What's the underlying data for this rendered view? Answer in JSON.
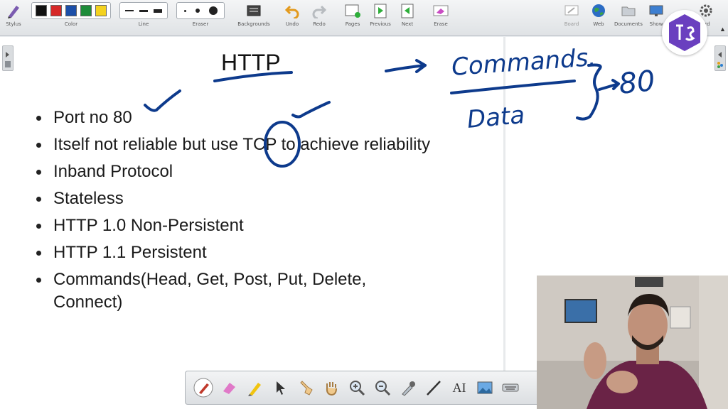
{
  "toolbar": {
    "stylus": "Stylus",
    "color": "Color",
    "line": "Line",
    "eraser": "Eraser",
    "backgrounds": "Backgrounds",
    "undo": "Undo",
    "redo": "Redo",
    "pages": "Pages",
    "previous": "Previous",
    "next": "Next",
    "erase": "Erase",
    "board": "Board",
    "web": "Web",
    "documents": "Documents",
    "show": "Show",
    "keyboard_partial": "ard",
    "colors": [
      "#111111",
      "#d62828",
      "#1c4fa8",
      "#1e8c3a",
      "#f4d21f"
    ]
  },
  "slide": {
    "title": "HTTP",
    "bullets": [
      "Port no 80",
      "Itself not reliable but use TCP to achieve reliability",
      "Inband Protocol",
      "Stateless",
      "HTTP 1.0 Non-Persistent",
      "HTTP 1.1 Persistent",
      "Commands(Head, Get, Post, Put, Delete, Connect)"
    ]
  },
  "annotations": {
    "commands": "Commands.",
    "data": "Data",
    "port": "80",
    "ink_color": "#0d3a8c"
  },
  "bottom_toolbar": {
    "text_tool": "AI"
  }
}
